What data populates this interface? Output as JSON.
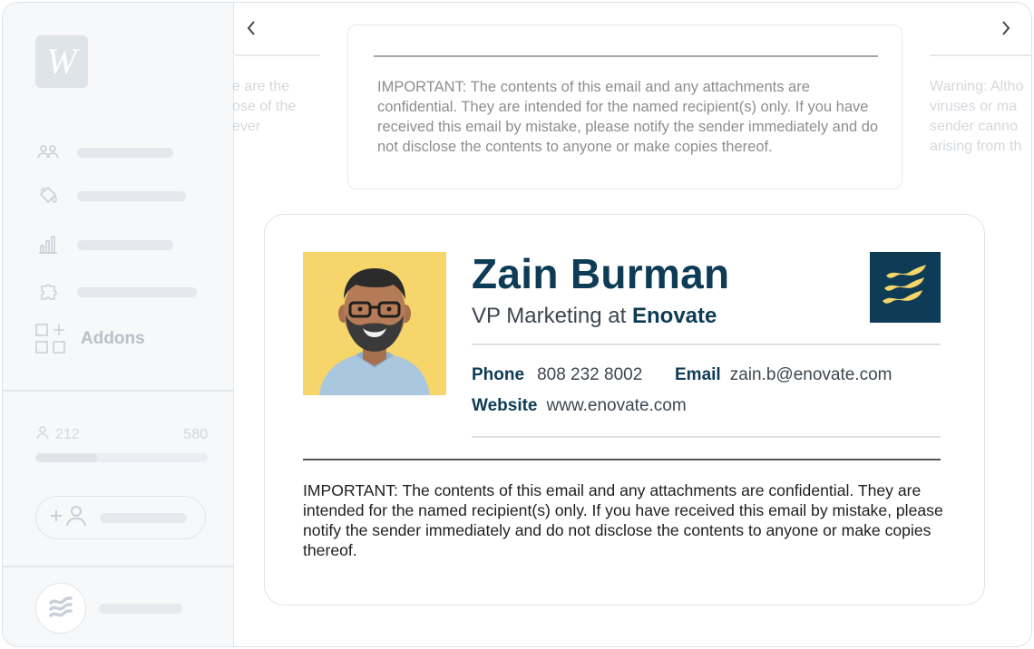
{
  "sidebar": {
    "logo_letter": "W",
    "nav_items": [
      {
        "icon": "users-icon"
      },
      {
        "icon": "paint-bucket-icon"
      },
      {
        "icon": "bar-chart-icon"
      },
      {
        "icon": "puzzle-icon"
      },
      {
        "icon": "addons-grid-icon",
        "label": "Addons"
      }
    ],
    "usage": {
      "used": "212",
      "total": "580",
      "fraction": 0.36
    },
    "add_user_icon": "add-user-icon",
    "account_icon": "enovate-wave-icon"
  },
  "main": {
    "ghost_left_lines": [
      "e are the",
      "ose of the",
      "ever"
    ],
    "ghost_right_lines": [
      "Warning: Altho",
      "viruses or ma",
      "sender canno",
      "arising from th"
    ],
    "preview_disclaimer": "IMPORTANT: The contents of this email and any attachments are confidential. They are intended for the named recipient(s) only. If you have received this email by mistake, please notify the sender immediately and do not disclose the contents to anyone or make copies thereof."
  },
  "signature": {
    "name": "Zain Burman",
    "title_prefix": "VP Marketing at",
    "company": "Enovate",
    "phone_label": "Phone",
    "phone": "808 232 8002",
    "email_label": "Email",
    "email": "zain.b@enovate.com",
    "website_label": "Website",
    "website": "www.enovate.com",
    "disclaimer": "IMPORTANT: The contents of this email and any attachments are confidential. They are intended for the named recipient(s) only. If you have received this email by mistake, please notify the sender immediately and do not disclose the contents to anyone or make copies thereof."
  },
  "colors": {
    "brand": "#0e3b55",
    "brand_accent": "#f6d56a",
    "photo_bg": "#f6d56a"
  }
}
